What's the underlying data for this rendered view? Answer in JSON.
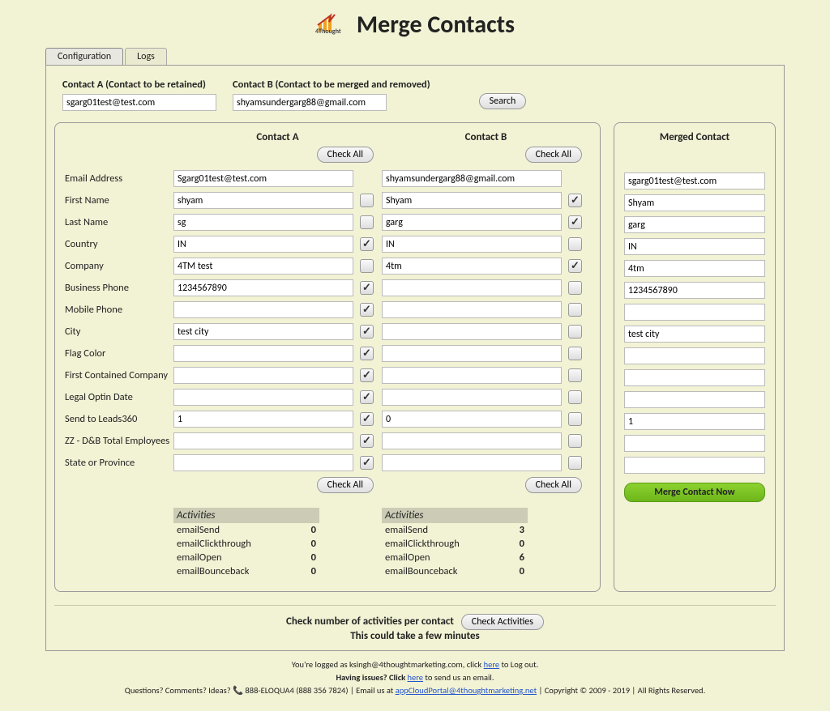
{
  "header": {
    "title": "Merge Contacts"
  },
  "tabs": {
    "a": "Configuration",
    "b": "Logs"
  },
  "search": {
    "labelA": "Contact A (Contact to be retained)",
    "labelB": "Contact B (Contact to be merged and removed)",
    "valueA": "sgarg01test@test.com",
    "valueB": "shyamsundergarg88@gmail.com",
    "btn": "Search"
  },
  "compare": {
    "titleA": "Contact A",
    "titleB": "Contact B",
    "checkAll": "Check All",
    "fields": [
      {
        "label": "Email Address",
        "a": "Sgarg01test@test.com",
        "ca": null,
        "b": "shyamsundergarg88@gmail.com",
        "cb": null
      },
      {
        "label": "First Name",
        "a": "shyam",
        "ca": false,
        "b": "Shyam",
        "cb": true
      },
      {
        "label": "Last Name",
        "a": "sg",
        "ca": false,
        "b": "garg",
        "cb": true
      },
      {
        "label": "Country",
        "a": "IN",
        "ca": true,
        "b": "IN",
        "cb": false
      },
      {
        "label": "Company",
        "a": "4TM test",
        "ca": false,
        "b": "4tm",
        "cb": true
      },
      {
        "label": "Business Phone",
        "a": "1234567890",
        "ca": true,
        "b": "",
        "cb": false
      },
      {
        "label": "Mobile Phone",
        "a": "",
        "ca": true,
        "b": "",
        "cb": false
      },
      {
        "label": "City",
        "a": "test city",
        "ca": true,
        "b": "",
        "cb": false
      },
      {
        "label": "Flag Color",
        "a": "",
        "ca": true,
        "b": "",
        "cb": false
      },
      {
        "label": "First Contained Company",
        "a": "",
        "ca": true,
        "b": "",
        "cb": false
      },
      {
        "label": "Legal Optin Date",
        "a": "",
        "ca": true,
        "b": "",
        "cb": false
      },
      {
        "label": "Send to Leads360",
        "a": "1",
        "ca": true,
        "b": "0",
        "cb": false
      },
      {
        "label": "ZZ - D&B Total Employees",
        "a": "",
        "ca": true,
        "b": "",
        "cb": false
      },
      {
        "label": "State or Province",
        "a": "",
        "ca": true,
        "b": "",
        "cb": false
      }
    ]
  },
  "activities": {
    "title": "Activities",
    "rowsA": [
      {
        "k": "emailSend",
        "v": "0"
      },
      {
        "k": "emailClickthrough",
        "v": "0"
      },
      {
        "k": "emailOpen",
        "v": "0"
      },
      {
        "k": "emailBounceback",
        "v": "0"
      }
    ],
    "rowsB": [
      {
        "k": "emailSend",
        "v": "3"
      },
      {
        "k": "emailClickthrough",
        "v": "0"
      },
      {
        "k": "emailOpen",
        "v": "6"
      },
      {
        "k": "emailBounceback",
        "v": "0"
      }
    ]
  },
  "merged": {
    "title": "Merged Contact",
    "values": [
      "sgarg01test@test.com",
      "Shyam",
      "garg",
      "IN",
      "4tm",
      "1234567890",
      "",
      "test city",
      "",
      "",
      "",
      "1",
      "",
      ""
    ],
    "btn": "Merge Contact Now"
  },
  "checkAct": {
    "line1": "Check number of activities per contact",
    "btn": "Check Activities",
    "line2": "This could take a few minutes"
  },
  "footer": {
    "l1a": "You're logged as ksingh@4thoughtmarketing.com, click ",
    "l1link": "here",
    "l1b": " to Log out.",
    "l2a": "Having issues? Click ",
    "l2link": "here",
    "l2b": " to send us an email.",
    "l3a": "Questions? Comments? Ideas? 📞 888-ELOQUA4 (888 356 7824) | Email us at ",
    "l3link": "appCloudPortal@4thoughtmarketing.net",
    "l3b": " | Copyright © 2009 - 2019 | All Rights Reserved."
  }
}
